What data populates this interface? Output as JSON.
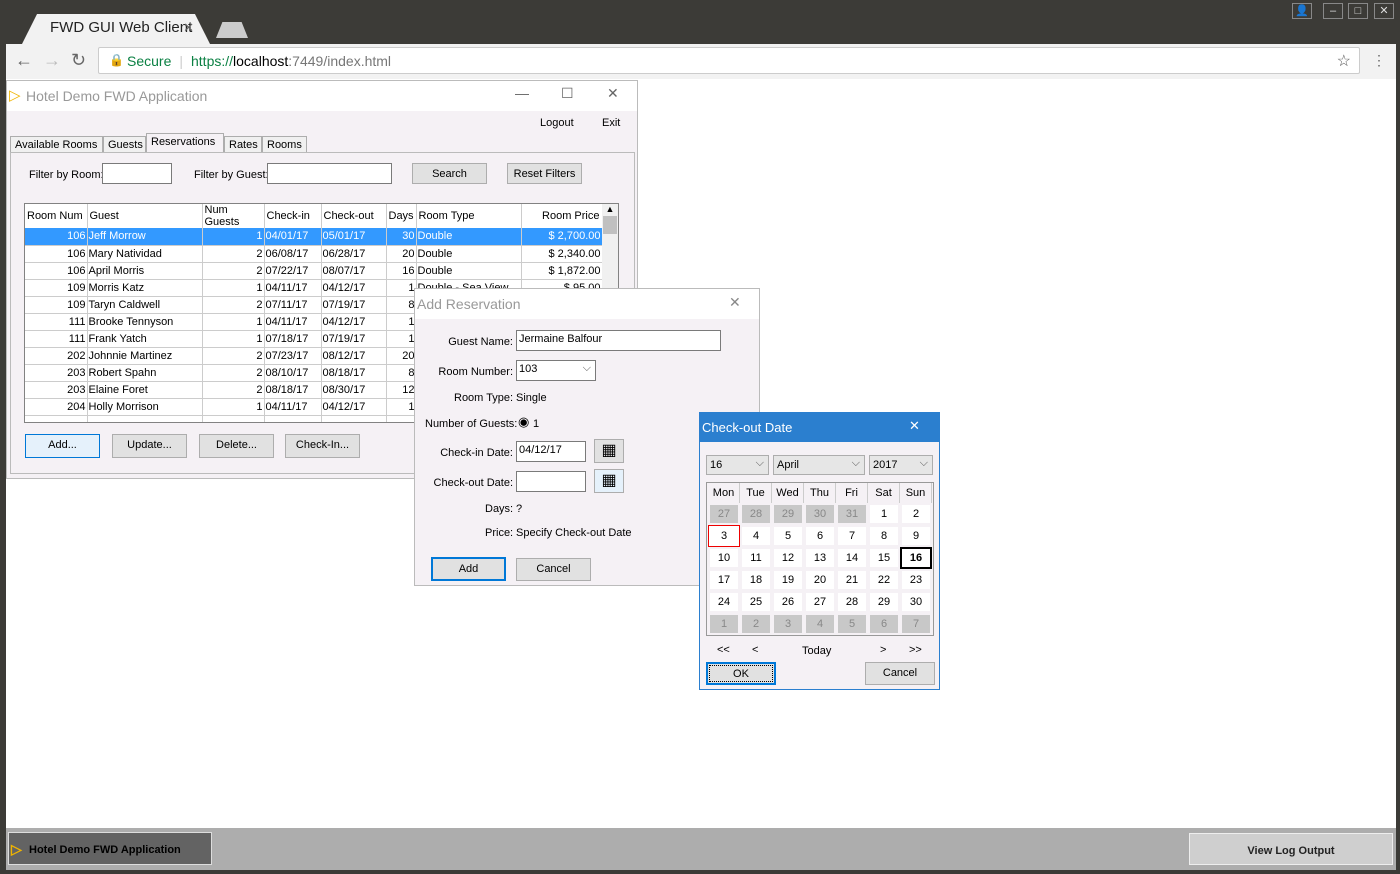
{
  "browser": {
    "tab_title": "FWD GUI Web Client",
    "secure_label": "Secure",
    "url_scheme": "https://",
    "url_host": "localhost",
    "url_rest": ":7449/index.html"
  },
  "main": {
    "title": "Hotel Demo FWD Application",
    "logout": "Logout",
    "exit": "Exit",
    "tabs": [
      "Available Rooms",
      "Guests",
      "Reservations",
      "Rates",
      "Rooms"
    ],
    "active_tab": "Reservations",
    "filter_room_label": "Filter by Room:",
    "filter_guest_label": "Filter by Guest:",
    "filter_room_value": "",
    "filter_guest_value": "",
    "search": "Search",
    "reset": "Reset Filters",
    "columns": [
      "Room Num",
      "Guest",
      "Num Guests",
      "Check-in",
      "Check-out",
      "Days",
      "Room Type",
      "Room Price"
    ],
    "rows": [
      [
        "106",
        "Jeff Morrow",
        "1",
        "04/01/17",
        "05/01/17",
        "30",
        "Double",
        "$ 2,700.00"
      ],
      [
        "106",
        "Mary Natividad",
        "2",
        "06/08/17",
        "06/28/17",
        "20",
        "Double",
        "$ 2,340.00"
      ],
      [
        "106",
        "April Morris",
        "2",
        "07/22/17",
        "08/07/17",
        "16",
        "Double",
        "$ 1,872.00"
      ],
      [
        "109",
        "Morris Katz",
        "1",
        "04/11/17",
        "04/12/17",
        "1",
        "Double - Sea View",
        "$ 95.00"
      ],
      [
        "109",
        "Taryn Caldwell",
        "2",
        "07/11/17",
        "07/19/17",
        "8",
        "",
        ""
      ],
      [
        "111",
        "Brooke Tennyson",
        "1",
        "04/11/17",
        "04/12/17",
        "1",
        "",
        ""
      ],
      [
        "111",
        "Frank Yatch",
        "1",
        "07/18/17",
        "07/19/17",
        "1",
        "",
        ""
      ],
      [
        "202",
        "Johnnie Martinez",
        "2",
        "07/23/17",
        "08/12/17",
        "20",
        "",
        ""
      ],
      [
        "203",
        "Robert Spahn",
        "2",
        "08/10/17",
        "08/18/17",
        "8",
        "",
        ""
      ],
      [
        "203",
        "Elaine Foret",
        "2",
        "08/18/17",
        "08/30/17",
        "12",
        "",
        ""
      ],
      [
        "204",
        "Holly Morrison",
        "1",
        "04/11/17",
        "04/12/17",
        "1",
        "",
        ""
      ]
    ],
    "buttons": {
      "add": "Add...",
      "update": "Update...",
      "delete": "Delete...",
      "checkin": "Check-In..."
    }
  },
  "add_dialog": {
    "title": "Add Reservation",
    "guest_label": "Guest Name:",
    "guest_value": "Jermaine Balfour",
    "room_label": "Room Number:",
    "room_value": "103",
    "type_label": "Room Type:",
    "type_value": "Single",
    "guests_label": "Number of Guests:",
    "guests_value": "1",
    "checkin_label": "Check-in Date:",
    "checkin_value": "04/12/17",
    "checkout_label": "Check-out Date:",
    "checkout_value": "",
    "days_label": "Days:",
    "days_value": "?",
    "price_label": "Price:",
    "price_value": "Specify Check-out Date",
    "add": "Add",
    "cancel": "Cancel"
  },
  "calendar": {
    "title": "Check-out Date",
    "day": "16",
    "month": "April",
    "year": "2017",
    "weekdays": [
      "Mon",
      "Tue",
      "Wed",
      "Thu",
      "Fri",
      "Sat",
      "Sun"
    ],
    "weeks": [
      [
        "27",
        "28",
        "29",
        "30",
        "31",
        "1",
        "2"
      ],
      [
        "3",
        "4",
        "5",
        "6",
        "7",
        "8",
        "9"
      ],
      [
        "10",
        "11",
        "12",
        "13",
        "14",
        "15",
        "16"
      ],
      [
        "17",
        "18",
        "19",
        "20",
        "21",
        "22",
        "23"
      ],
      [
        "24",
        "25",
        "26",
        "27",
        "28",
        "29",
        "30"
      ],
      [
        "1",
        "2",
        "3",
        "4",
        "5",
        "6",
        "7"
      ]
    ],
    "nav_prev_year": "<<",
    "nav_prev": "<",
    "today": "Today",
    "nav_next": ">",
    "nav_next_year": ">>",
    "ok": "OK",
    "cancel": "Cancel",
    "title_color": "#2b7fcf"
  },
  "taskbar": {
    "app": "Hotel Demo FWD Application",
    "log": "View Log Output"
  }
}
